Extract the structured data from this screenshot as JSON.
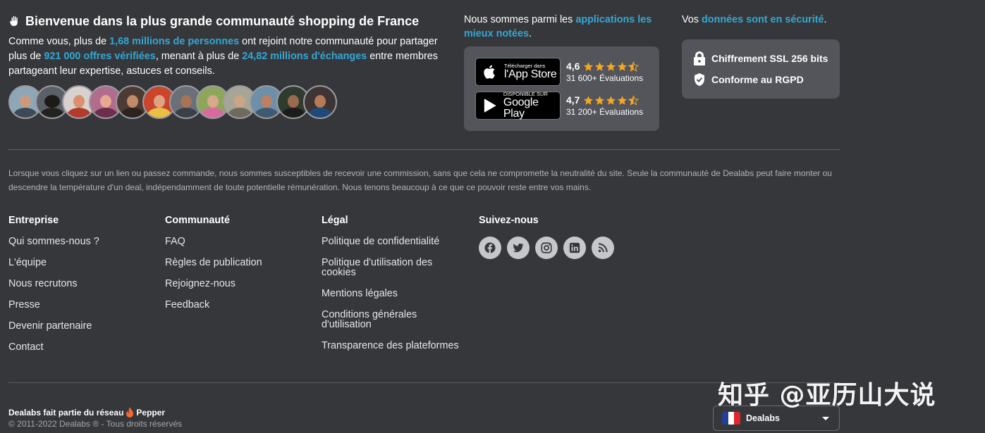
{
  "community": {
    "title": "Bienvenue dans la plus grande communauté shopping de France",
    "text_1": "Comme vous, plus de ",
    "members": "1,68 millions de personnes",
    "text_2": " ont rejoint notre communauté pour partager plus de ",
    "offers": "921 000 offres vérifiées",
    "text_3": ", menant à plus de ",
    "exchanges": "24,82 millions d'échanges",
    "text_4": " entre membres partageant leur expertise, astuces et conseils."
  },
  "apps": {
    "intro_1": "Nous sommes parmi les ",
    "intro_link": "applications les mieux notées",
    "intro_2": ".",
    "stores": [
      {
        "small": "Télécharger dans",
        "big": "l'App Store",
        "score": "4,6",
        "stars": 4.5,
        "count": "31 600+ Évaluations"
      },
      {
        "small": "DISPONIBLE SUR",
        "big": "Google Play",
        "score": "4,7",
        "stars": 4.5,
        "count": "31 200+ Évaluations"
      }
    ]
  },
  "security": {
    "intro_1": "Vos ",
    "intro_link": "données sont en sécurité",
    "intro_2": ".",
    "ssl": "Chiffrement SSL 256 bits",
    "gdpr": "Conforme au RGPD"
  },
  "disclaimer": "Lorsque vous cliquez sur un lien ou passez commande, nous sommes susceptibles de recevoir une commission, sans que cela ne compromette la neutralité du site. Seule la communauté de Dealabs peut faire monter ou descendre la température d'un deal, indépendamment de toute potentielle rémunération. Nous tenons beaucoup à ce que ce pouvoir reste entre vos mains.",
  "footer": {
    "company": {
      "title": "Entreprise",
      "links": [
        "Qui sommes-nous ?",
        "L'équipe",
        "Nous recrutons",
        "Presse",
        "Devenir partenaire",
        "Contact"
      ]
    },
    "community": {
      "title": "Communauté",
      "links": [
        "FAQ",
        "Règles de publication",
        "Rejoignez-nous",
        "Feedback"
      ]
    },
    "legal": {
      "title": "Légal",
      "links": [
        [
          "Politique de confidentialité"
        ],
        [
          "Politique d'utilisation des",
          "cookies"
        ],
        [
          "Mentions légales"
        ],
        [
          "Conditions générales",
          "d'utilisation"
        ],
        [
          "Transparence des plateformes"
        ]
      ]
    },
    "follow": {
      "title": "Suivez-nous",
      "icons": [
        "facebook-icon",
        "twitter-icon",
        "instagram-icon",
        "linkedin-icon",
        "rss-icon"
      ]
    }
  },
  "bottom": {
    "network": "Dealabs fait partie du réseau",
    "pepper": "Pepper",
    "copyright": "© 2011-2022 Dealabs ® - Tous droits réservés",
    "country": "Dealabs"
  },
  "watermark": "知乎 @亚历山大说",
  "colors": {
    "background": "#36373b",
    "accent": "#32a8d6",
    "star": "#f5a623",
    "box": "#53555a"
  }
}
